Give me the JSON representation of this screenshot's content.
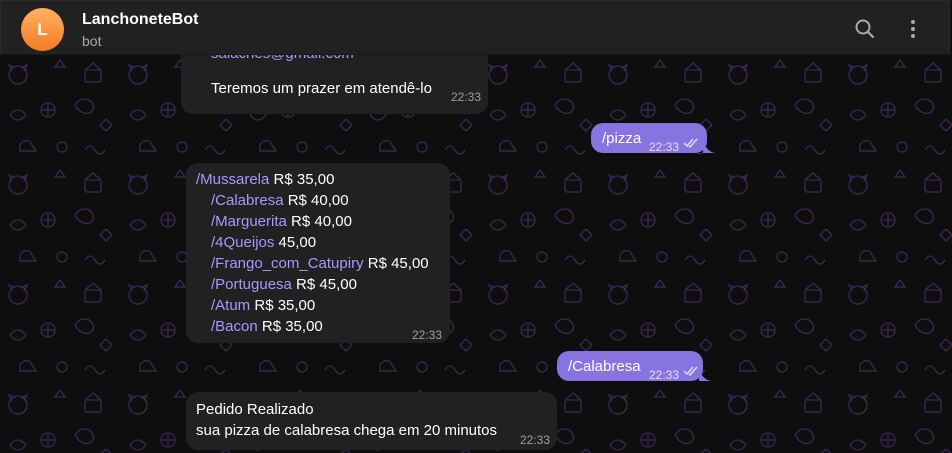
{
  "header": {
    "avatar_letter": "L",
    "title": "LanchoneteBot",
    "subtitle": "bot",
    "search_icon": "search-icon",
    "more_icon": "more-vertical-icon"
  },
  "colors": {
    "header_bg": "#212121",
    "incoming_bubble": "#212121",
    "outgoing_bubble": "#8774e1",
    "command_link": "#a898ff",
    "avatar": "#f57a26"
  },
  "messages": {
    "m1": {
      "partial_text": "salaches@gmail.com",
      "text": "Teremos um prazer em atendê-lo",
      "time": "22:33"
    },
    "m2": {
      "text": "/pizza",
      "time": "22:33"
    },
    "m3": {
      "items": [
        {
          "command": "/Mussarela",
          "price": " R$ 35,00"
        },
        {
          "command": "/Calabresa",
          "price": " R$ 40,00"
        },
        {
          "command": "/Marguerita",
          "price": " R$ 40,00"
        },
        {
          "command": "/4Queijos",
          "price": " 45,00"
        },
        {
          "command": "/Frango_com_Catupiry",
          "price": " R$ 45,00"
        },
        {
          "command": "/Portuguesa",
          "price": " R$ 45,00"
        },
        {
          "command": "/Atum",
          "price": " R$ 35,00"
        },
        {
          "command": "/Bacon",
          "price": " R$ 35,00"
        }
      ],
      "time": "22:33"
    },
    "m4": {
      "text": "/Calabresa",
      "time": "22:33"
    },
    "m5": {
      "line1": "Pedido Realizado",
      "line2": "sua pizza de calabresa chega em 20 minutos",
      "time": "22:33"
    }
  }
}
